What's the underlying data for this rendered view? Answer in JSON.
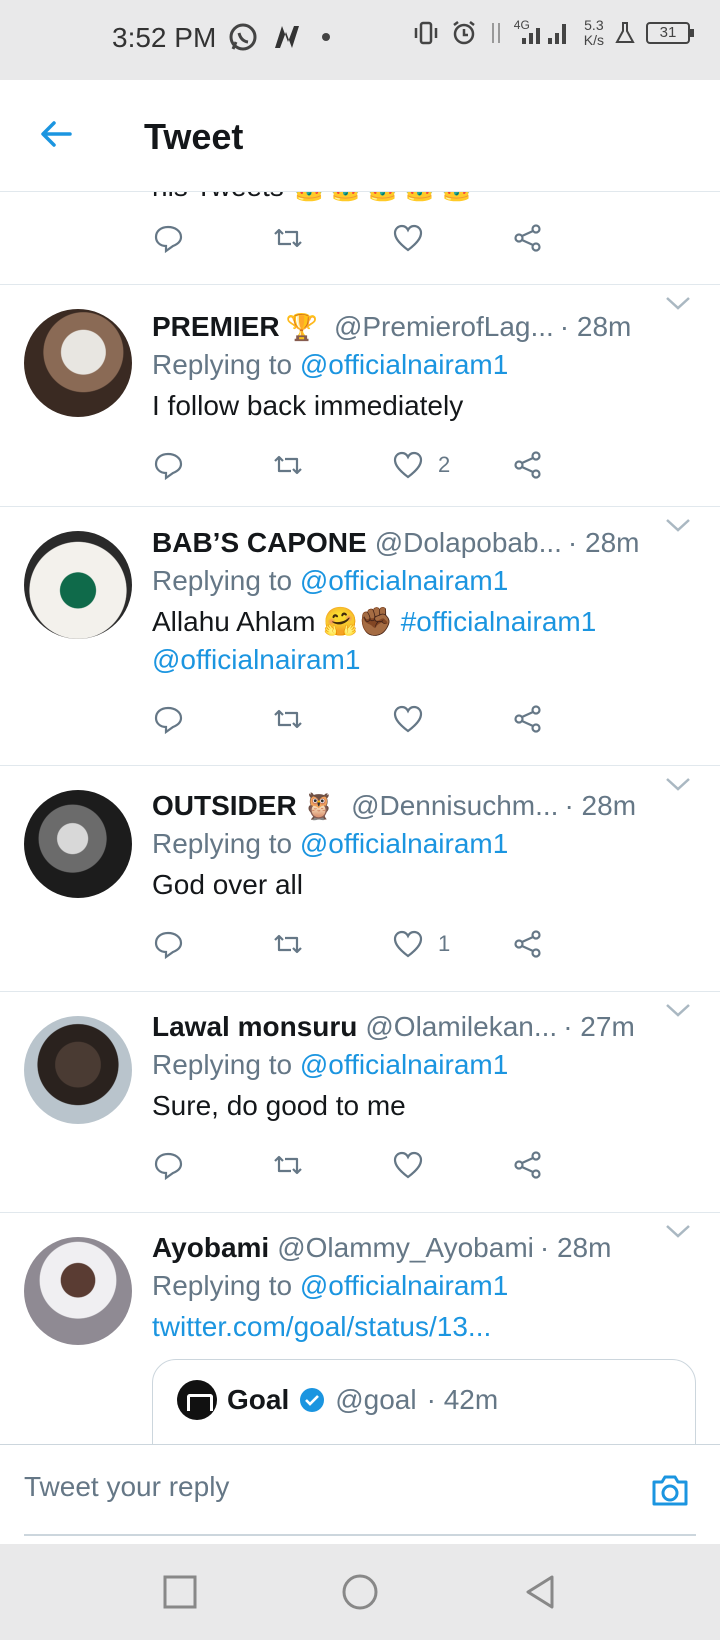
{
  "status_bar": {
    "time": "3:52 PM",
    "network_speed": "5.3",
    "network_speed_unit": "K/s",
    "network_type": "4G",
    "battery": "31"
  },
  "header": {
    "title": "Tweet"
  },
  "partial_tweet": {
    "text": "his Tweets"
  },
  "tweets": [
    {
      "name": "PREMIER",
      "emoji": "🏆",
      "handle": "@PremierofLag...",
      "time": "· 28m",
      "replying_prefix": "Replying to",
      "replying_to": "@officialnairam1",
      "body": "I follow back immediately",
      "likes": "2"
    },
    {
      "name": "BAB’S CAPONE",
      "emoji": "",
      "handle": "@Dolapobab...",
      "time": "· 28m",
      "replying_prefix": "Replying to",
      "replying_to": "@officialnairam1",
      "body": "Allahu Ahlam 🤗✊🏾",
      "hashtag": "#officialnairam1",
      "mention": "@officialnairam1",
      "likes": ""
    },
    {
      "name": "OUTSIDER",
      "emoji": "🦉",
      "handle": "@Dennisuchm...",
      "time": "· 28m",
      "replying_prefix": "Replying to",
      "replying_to": "@officialnairam1",
      "body": "God over all",
      "likes": "1"
    },
    {
      "name": "Lawal monsuru",
      "emoji": "",
      "handle": "@Olamilekan...",
      "time": "· 27m",
      "replying_prefix": "Replying to",
      "replying_to": "@officialnairam1",
      "body": "Sure, do good to me",
      "likes": ""
    },
    {
      "name": "Ayobami",
      "emoji": "",
      "handle": "@Olammy_Ayobami",
      "time": "· 28m",
      "replying_prefix": "Replying to",
      "replying_to": "@officialnairam1",
      "link": "twitter.com/goal/status/13...",
      "quote": {
        "name": "Goal",
        "handle": "@goal",
        "time": "· 42m"
      }
    }
  ],
  "composer": {
    "placeholder": "Tweet your reply"
  },
  "colors": {
    "accent": "#1b95e0",
    "muted": "#657786",
    "divider": "#e1e8ed"
  }
}
